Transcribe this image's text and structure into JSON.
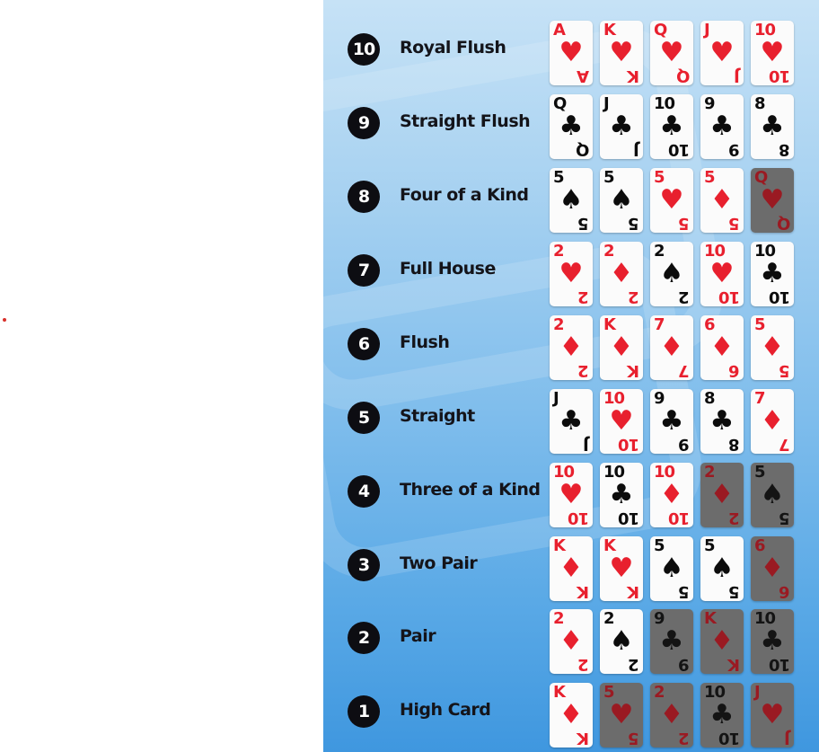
{
  "hands": [
    {
      "rank": "10",
      "name": "Royal Flush",
      "cards": [
        {
          "value": "A",
          "suit": "♥",
          "color": "red",
          "dim": false
        },
        {
          "value": "K",
          "suit": "♥",
          "color": "red",
          "dim": false
        },
        {
          "value": "Q",
          "suit": "♥",
          "color": "red",
          "dim": false
        },
        {
          "value": "J",
          "suit": "♥",
          "color": "red",
          "dim": false
        },
        {
          "value": "10",
          "suit": "♥",
          "color": "red",
          "dim": false
        }
      ]
    },
    {
      "rank": "9",
      "name": "Straight Flush",
      "cards": [
        {
          "value": "Q",
          "suit": "♣",
          "color": "black",
          "dim": false
        },
        {
          "value": "J",
          "suit": "♣",
          "color": "black",
          "dim": false
        },
        {
          "value": "10",
          "suit": "♣",
          "color": "black",
          "dim": false
        },
        {
          "value": "9",
          "suit": "♣",
          "color": "black",
          "dim": false
        },
        {
          "value": "8",
          "suit": "♣",
          "color": "black",
          "dim": false
        }
      ]
    },
    {
      "rank": "8",
      "name": "Four of a Kind",
      "cards": [
        {
          "value": "5",
          "suit": "♠",
          "color": "black",
          "dim": false
        },
        {
          "value": "5",
          "suit": "♠",
          "color": "black",
          "dim": false
        },
        {
          "value": "5",
          "suit": "♥",
          "color": "red",
          "dim": false
        },
        {
          "value": "5",
          "suit": "♦",
          "color": "red",
          "dim": false
        },
        {
          "value": "Q",
          "suit": "♥",
          "color": "red",
          "dim": true
        }
      ]
    },
    {
      "rank": "7",
      "name": "Full House",
      "cards": [
        {
          "value": "2",
          "suit": "♥",
          "color": "red",
          "dim": false
        },
        {
          "value": "2",
          "suit": "♦",
          "color": "red",
          "dim": false
        },
        {
          "value": "2",
          "suit": "♠",
          "color": "black",
          "dim": false
        },
        {
          "value": "10",
          "suit": "♥",
          "color": "red",
          "dim": false
        },
        {
          "value": "10",
          "suit": "♣",
          "color": "black",
          "dim": false
        }
      ]
    },
    {
      "rank": "6",
      "name": "Flush",
      "cards": [
        {
          "value": "2",
          "suit": "♦",
          "color": "red",
          "dim": false
        },
        {
          "value": "K",
          "suit": "♦",
          "color": "red",
          "dim": false
        },
        {
          "value": "7",
          "suit": "♦",
          "color": "red",
          "dim": false
        },
        {
          "value": "6",
          "suit": "♦",
          "color": "red",
          "dim": false
        },
        {
          "value": "5",
          "suit": "♦",
          "color": "red",
          "dim": false
        }
      ]
    },
    {
      "rank": "5",
      "name": "Straight",
      "cards": [
        {
          "value": "J",
          "suit": "♣",
          "color": "black",
          "dim": false
        },
        {
          "value": "10",
          "suit": "♥",
          "color": "red",
          "dim": false
        },
        {
          "value": "9",
          "suit": "♣",
          "color": "black",
          "dim": false
        },
        {
          "value": "8",
          "suit": "♣",
          "color": "black",
          "dim": false
        },
        {
          "value": "7",
          "suit": "♦",
          "color": "red",
          "dim": false
        }
      ]
    },
    {
      "rank": "4",
      "name": "Three of a Kind",
      "cards": [
        {
          "value": "10",
          "suit": "♥",
          "color": "red",
          "dim": false
        },
        {
          "value": "10",
          "suit": "♣",
          "color": "black",
          "dim": false
        },
        {
          "value": "10",
          "suit": "♦",
          "color": "red",
          "dim": false
        },
        {
          "value": "2",
          "suit": "♦",
          "color": "red",
          "dim": true
        },
        {
          "value": "5",
          "suit": "♠",
          "color": "black",
          "dim": true
        }
      ]
    },
    {
      "rank": "3",
      "name": "Two Pair",
      "cards": [
        {
          "value": "K",
          "suit": "♦",
          "color": "red",
          "dim": false
        },
        {
          "value": "K",
          "suit": "♥",
          "color": "red",
          "dim": false
        },
        {
          "value": "5",
          "suit": "♠",
          "color": "black",
          "dim": false
        },
        {
          "value": "5",
          "suit": "♠",
          "color": "black",
          "dim": false
        },
        {
          "value": "6",
          "suit": "♦",
          "color": "red",
          "dim": true
        }
      ]
    },
    {
      "rank": "2",
      "name": "Pair",
      "cards": [
        {
          "value": "2",
          "suit": "♦",
          "color": "red",
          "dim": false
        },
        {
          "value": "2",
          "suit": "♠",
          "color": "black",
          "dim": false
        },
        {
          "value": "9",
          "suit": "♣",
          "color": "black",
          "dim": true
        },
        {
          "value": "K",
          "suit": "♦",
          "color": "red",
          "dim": true
        },
        {
          "value": "10",
          "suit": "♣",
          "color": "black",
          "dim": true
        }
      ]
    },
    {
      "rank": "1",
      "name": "High Card",
      "cards": [
        {
          "value": "K",
          "suit": "♦",
          "color": "red",
          "dim": false
        },
        {
          "value": "5",
          "suit": "♥",
          "color": "red",
          "dim": true
        },
        {
          "value": "2",
          "suit": "♦",
          "color": "red",
          "dim": true
        },
        {
          "value": "10",
          "suit": "♣",
          "color": "black",
          "dim": true
        },
        {
          "value": "J",
          "suit": "♥",
          "color": "red",
          "dim": true
        }
      ]
    }
  ]
}
